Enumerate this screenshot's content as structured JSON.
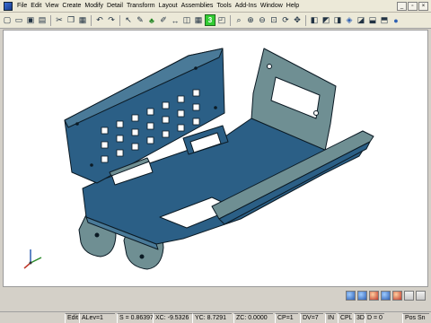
{
  "menu": {
    "items": [
      "File",
      "Edit",
      "View",
      "Create",
      "Modify",
      "Detail",
      "Transform",
      "Layout",
      "Assemblies",
      "Tools",
      "Add-Ins",
      "Window",
      "Help"
    ],
    "controls": [
      "_",
      "▫",
      "×"
    ]
  },
  "toolbar": {
    "icons": [
      "new-file-icon",
      "open-file-icon",
      "save-icon",
      "print-icon",
      "cut-icon",
      "copy-icon",
      "paste-icon",
      "undo-icon",
      "redo-icon",
      "select-icon",
      "repaint-icon",
      "paint-icon",
      "pen-icon",
      "transform-icon",
      "layer-icon",
      "grid-icon",
      "snap-icon",
      "zoom-icon",
      "zoom-in-icon",
      "zoom-out-icon",
      "fit-icon",
      "rotate-icon",
      "pan-icon",
      "view-front-icon",
      "view-top-icon",
      "view-right-icon",
      "view-iso-icon",
      "view-back-icon",
      "view-bottom-icon",
      "view-left-icon",
      "shade-icon"
    ],
    "level_value": "3"
  },
  "view_toolbar": {
    "icons": [
      "shaded-icon",
      "hidden-line-icon",
      "wireframe-icon",
      "render-icon",
      "light-icon",
      "material-icon",
      "clip-icon"
    ]
  },
  "status": {
    "mode": "Edit",
    "alev": "ALev=1",
    "s": "S = 0.86397",
    "xc": "XC: -9.5326",
    "yc": "YC: 8.7291",
    "zc": "ZC: 0.0000",
    "cp": "CP=1",
    "dv": "DV=7",
    "units": "IN",
    "cpl": "CPL",
    "d3": "3D",
    "d": "D = 0",
    "pos": "Pos Sn"
  },
  "colors": {
    "part_top": "#2b5f86",
    "part_side": "#6f8f93",
    "part_edge": "#0b1a24"
  }
}
